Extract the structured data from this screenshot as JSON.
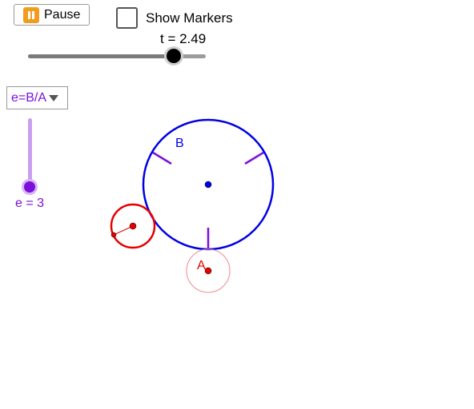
{
  "controls": {
    "pause_label": "Pause",
    "show_markers_label": "Show Markers",
    "show_markers_checked": false,
    "t_label": "t = 2.49",
    "t_fraction": 0.82,
    "mode_selected": "e=B/A",
    "e_label": "e = 3",
    "e_fraction": 0.09
  },
  "geometry_labels": {
    "big_circle": "B",
    "small_circle": "A"
  },
  "colors": {
    "big_circle": "#0000e6",
    "marker": "#7c0fdc",
    "rolling_circle": "#e60000",
    "ghost_circle": "#f08a8a",
    "accent": "#7c0fdc",
    "pause_icon": "#f29c1f"
  }
}
